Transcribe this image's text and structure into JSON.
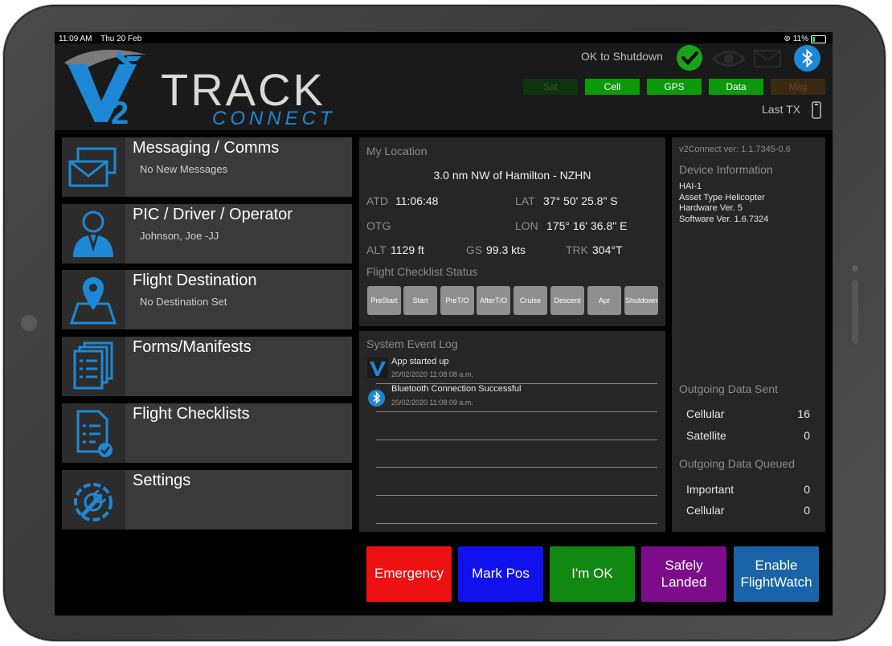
{
  "status_bar": {
    "time": "11:09 AM",
    "date": "Thu 20 Feb",
    "battery": "11%"
  },
  "header": {
    "logo_track": "TRACK",
    "logo_connect": "CONNECT",
    "logo_v": "V",
    "logo_2": "2",
    "shutdown_label": "OK to Shutdown",
    "indicators": [
      {
        "label": "Sat",
        "bg": "#0f330f",
        "fg": "#2d5a2d"
      },
      {
        "label": "Cell",
        "bg": "#0a9a0a",
        "fg": "#ffffff"
      },
      {
        "label": "GPS",
        "bg": "#0a9a0a",
        "fg": "#ffffff"
      },
      {
        "label": "Data",
        "bg": "#0a9a0a",
        "fg": "#ffffff"
      },
      {
        "label": "Msg",
        "bg": "#3a2a12",
        "fg": "#5e4a2c"
      }
    ],
    "last_tx_label": "Last TX",
    "icons": [
      "check-icon",
      "eye-icon",
      "mail-icon",
      "bluetooth-icon",
      "phone-icon"
    ]
  },
  "menu": [
    {
      "title": "Messaging / Comms",
      "subtitle": "No New Messages",
      "icon": "envelope-icon"
    },
    {
      "title": "PIC / Driver / Operator",
      "subtitle": "Johnson, Joe -JJ",
      "icon": "person-icon"
    },
    {
      "title": "Flight Destination",
      "subtitle": "No Destination Set",
      "icon": "map-pin-icon"
    },
    {
      "title": "Forms/Manifests",
      "subtitle": "",
      "icon": "forms-icon"
    },
    {
      "title": "Flight Checklists",
      "subtitle": "",
      "icon": "checklist-icon"
    },
    {
      "title": "Settings",
      "subtitle": "",
      "icon": "settings-icon"
    }
  ],
  "location": {
    "title": "My Location",
    "place": "3.0 nm NW of Hamilton - NZHN",
    "atd_label": "ATD",
    "atd": "11:06:48",
    "lat_label": "LAT",
    "lat": "37° 50' 25.8\" S",
    "otg_label": "OTG",
    "lon_label": "LON",
    "lon": "175° 16' 36.8\" E",
    "alt_label": "ALT",
    "alt": "1129 ft",
    "gs_label": "GS",
    "gs": "99.3 kts",
    "trk_label": "TRK",
    "trk": "304°T",
    "checklist_title": "Flight Checklist Status",
    "checklist": [
      "PreStart",
      "Start",
      "PreT/O",
      "AfterT/O",
      "Cruise",
      "Descent",
      "Apr",
      "Shutdown"
    ]
  },
  "event_log": {
    "title": "System Event Log",
    "events": [
      {
        "title": "App started up",
        "time": "20/02/2020 11:08:08 a.m.",
        "icon": "app-logo-icon"
      },
      {
        "title": "Bluetooth Connection Successful",
        "time": "20/02/2020 11:08:09 a.m.",
        "icon": "bluetooth-icon"
      }
    ]
  },
  "device": {
    "version": "v2Connect ver: 1.1.7345-0.6",
    "info_title": "Device Information",
    "info_lines": [
      "HAI-1",
      "Asset Type Helicopter",
      "Hardware Ver. 5",
      "Software Ver. 1.6.7324"
    ],
    "sent_title": "Outgoing Data Sent",
    "sent": [
      {
        "label": "Cellular",
        "value": "16"
      },
      {
        "label": "Satellite",
        "value": "0"
      }
    ],
    "queued_title": "Outgoing Data Queued",
    "queued": [
      {
        "label": "Important",
        "value": "0"
      },
      {
        "label": "Cellular",
        "value": "0"
      }
    ]
  },
  "actions": [
    {
      "label": "Emergency",
      "color": "#ee1111"
    },
    {
      "label": "Mark Pos",
      "color": "#1111ee"
    },
    {
      "label": "I'm OK",
      "color": "#118811"
    },
    {
      "label": "Safely Landed",
      "color": "#7d0c8a"
    },
    {
      "label": "Enable FlightWatch",
      "color": "#1a63a8"
    }
  ]
}
